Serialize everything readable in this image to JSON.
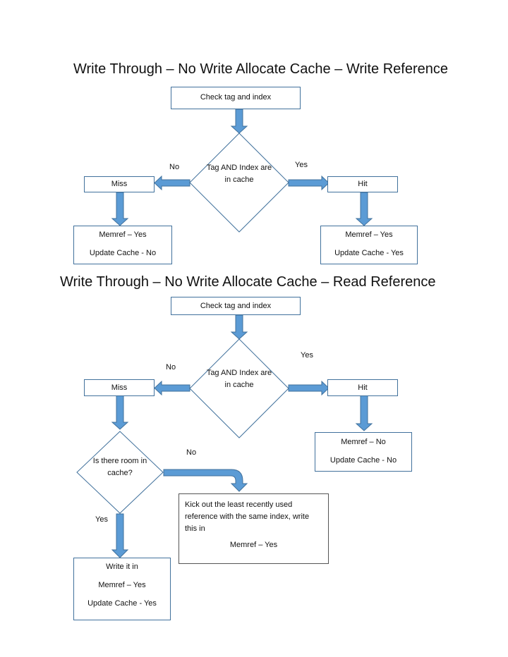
{
  "colors": {
    "arrow_fill": "#5b9bd5",
    "arrow_stroke": "#41719c",
    "box_border": "#41719c",
    "diamond_stroke": "#41719c"
  },
  "write_flow": {
    "title": "Write Through – No Write Allocate Cache – Write Reference",
    "start": "Check tag and index",
    "decision": [
      "Tag AND",
      "Index are",
      "in cache"
    ],
    "no_label": "No",
    "yes_label": "Yes",
    "miss": "Miss",
    "hit": "Hit",
    "miss_result": [
      "Memref – Yes",
      "Update Cache - No"
    ],
    "hit_result": [
      "Memref – Yes",
      "Update Cache - Yes"
    ]
  },
  "read_flow": {
    "title": "Write Through – No Write Allocate Cache – Read Reference",
    "start": "Check tag and index",
    "decision": [
      "Tag AND",
      "Index are",
      "in cache"
    ],
    "no_label": "No",
    "yes_label": "Yes",
    "miss": "Miss",
    "hit": "Hit",
    "hit_result": [
      "Memref – No",
      "Update Cache - No"
    ],
    "room_decision": [
      "Is there",
      "room in",
      "cache?"
    ],
    "room_no_label": "No",
    "room_yes_label": "Yes",
    "evict_box": [
      "Kick out the least recently used",
      "reference with the same index, write",
      "this in",
      "Memref – Yes"
    ],
    "write_box": [
      "Write it in",
      "Memref – Yes",
      "Update Cache - Yes"
    ]
  }
}
